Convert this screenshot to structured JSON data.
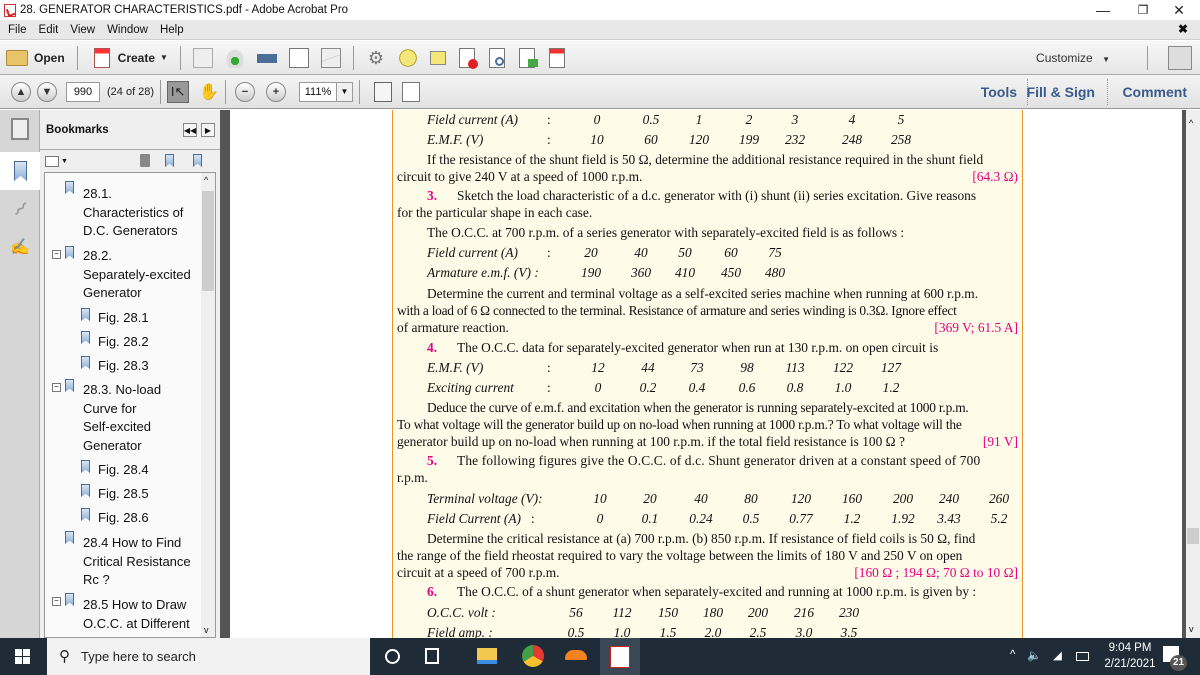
{
  "window": {
    "title": "28. GENERATOR CHARACTERISTICS.pdf - Adobe Acrobat Pro",
    "controls": {
      "minimize": "—",
      "restore": "❐",
      "close": "✕"
    }
  },
  "menu": [
    "File",
    "Edit",
    "View",
    "Window",
    "Help"
  ],
  "menu_close": "✖",
  "toolbar": {
    "open_label": "Open",
    "create_label": "Create",
    "customize_label": "Customize",
    "icons": [
      "save-icon",
      "cloud-upload-icon",
      "print-icon",
      "edit-doc-icon",
      "email-icon",
      "gear-icon",
      "comment-icon",
      "highlight-text-icon",
      "delete-pages-icon",
      "search-doc-icon",
      "export-icon",
      "sign-doc-icon"
    ]
  },
  "navbar": {
    "page_number": "990",
    "page_of": "(24 of 28)",
    "zoom": "111%",
    "tabs": [
      "Tools",
      "Fill & Sign",
      "Comment"
    ]
  },
  "bookmarks": {
    "title": "Bookmarks",
    "items": [
      {
        "lines": [
          "28.1.",
          "Characteristics of",
          "D.C. Generators"
        ],
        "level": 0,
        "expandable": false
      },
      {
        "lines": [
          "28.2.",
          "Separately-excited",
          "Generator"
        ],
        "level": 0,
        "expandable": true
      },
      {
        "lines": [
          "Fig. 28.1"
        ],
        "level": 1
      },
      {
        "lines": [
          "Fig. 28.2"
        ],
        "level": 1
      },
      {
        "lines": [
          "Fig. 28.3"
        ],
        "level": 1
      },
      {
        "lines": [
          "28.3. No-load",
          "Curve for",
          "Self-excited",
          "Generator"
        ],
        "level": 0,
        "expandable": true
      },
      {
        "lines": [
          "Fig. 28.4"
        ],
        "level": 1
      },
      {
        "lines": [
          "Fig. 28.5"
        ],
        "level": 1
      },
      {
        "lines": [
          "Fig. 28.6"
        ],
        "level": 1
      },
      {
        "lines": [
          "28.4 How to Find",
          "Critical Resistance",
          "Rc ?"
        ],
        "level": 0,
        "expandable": false
      },
      {
        "lines": [
          "28.5 How to Draw",
          "O.C.C. at Different"
        ],
        "level": 0,
        "expandable": true
      }
    ]
  },
  "document": {
    "t1": {
      "labels": [
        "Field current (A)",
        "E.M.F.  (V)"
      ],
      "sep": ":",
      "row1": [
        "0",
        "0.5",
        "1",
        "2",
        "3",
        "4",
        "5"
      ],
      "row2": [
        "10",
        "60",
        "120",
        "199",
        "232",
        "248",
        "258"
      ]
    },
    "p1a": "If the resistance of the shunt field is 50 Ω, determine the additional resistance required in the shunt field",
    "p1b": "circuit to give 240 V at a speed of 1000 r.p.m.",
    "a1": "[64.3 Ω)",
    "q3_num": "3.",
    "q3a": "Sketch the load characteristic of a d.c. generator with (i) shunt (ii) series excitation.  Give reasons",
    "q3b": "for the particular shape in each case.",
    "p2": "The O.C.C. at 700 r.p.m. of a series generator with separately-excited field is as follows :",
    "t2": {
      "labels": [
        "Field current (A)",
        "Armature e.m.f. (V) :"
      ],
      "row1": [
        "20",
        "40",
        "50",
        "60",
        "75"
      ],
      "row2": [
        "190",
        "360",
        "410",
        "450",
        "480"
      ]
    },
    "p3a": "Determine the current and terminal voltage as a self-excited series machine when running at 600 r.p.m.",
    "p3b": "with a load of 6 Ω connected to the terminal.  Resistance of armature and series winding is 0.3Ω.  Ignore effect",
    "p3c": "of armature reaction.",
    "a2": "[369 V; 61.5 A]",
    "q4_num": "4.",
    "q4": "The O.C.C. data for separately-excited generator when run at 130 r.p.m. on open circuit is",
    "t3": {
      "labels": [
        "E.M.F. (V)",
        "Exciting current"
      ],
      "row1": [
        "12",
        "44",
        "73",
        "98",
        "113",
        "122",
        "127"
      ],
      "row2": [
        "0",
        "0.2",
        "0.4",
        "0.6",
        "0.8",
        "1.0",
        "1.2"
      ]
    },
    "p4a": "Deduce the curve of e.m.f. and excitation when the generator is running separately-excited at 1000 r.p.m.",
    "p4b": "To what voltage will the generator build up on no-load when running at 1000 r.p.m.?  To what voltage will the",
    "p4c": "generator build up on no-load when running at 100 r.p.m. if the total field resistance is 100 Ω ?",
    "a3": "[91 V]",
    "q5_num": "5.",
    "q5a": "The following figures give the O.C.C. of d.c. Shunt generator driven at a constant speed of 700",
    "q5b": "r.p.m.",
    "t4": {
      "labels": [
        "Terminal voltage (V):",
        "Field Current (A)"
      ],
      "row1": [
        "10",
        "20",
        "40",
        "80",
        "120",
        "160",
        "200",
        "240",
        "260"
      ],
      "row2": [
        "0",
        "0.1",
        "0.24",
        "0.5",
        "0.77",
        "1.2",
        "1.92",
        "3.43",
        "5.2"
      ]
    },
    "p5a": "Determine the critical resistance at (a) 700 r.p.m. (b) 850 r.p.m.  If resistance of field coils is 50 Ω, find",
    "p5b": "the range of the field rheostat required to vary the voltage between the limits of 180 V and 250 V on open",
    "p5c": "circuit at a speed of 700 r.p.m.",
    "a4": "[160 Ω ; 194 Ω; 70 Ω to 10 Ω]",
    "q6_num": "6.",
    "q6": "The O.C.C. of a shunt generator when separately-excited and running at 1000 r.p.m. is given by :",
    "t5": {
      "labels": [
        "O.C.C. volt :",
        "Field amp. :"
      ],
      "row1": [
        "56",
        "112",
        "150",
        "180",
        "200",
        "216",
        "230"
      ],
      "row2": [
        "0.5",
        "1.0",
        "1.5",
        "2.0",
        "2.5",
        "3.0",
        "3.5"
      ]
    }
  },
  "taskbar": {
    "search_placeholder": "Type here to search",
    "time": "9:04 PM",
    "date": "2/21/2021",
    "notifications": "21"
  },
  "colors": {
    "accent_answer": "#e5007e",
    "box_border": "#e8952a",
    "box_bg": "#fefbe8",
    "tab_text": "#3a5a8a"
  }
}
